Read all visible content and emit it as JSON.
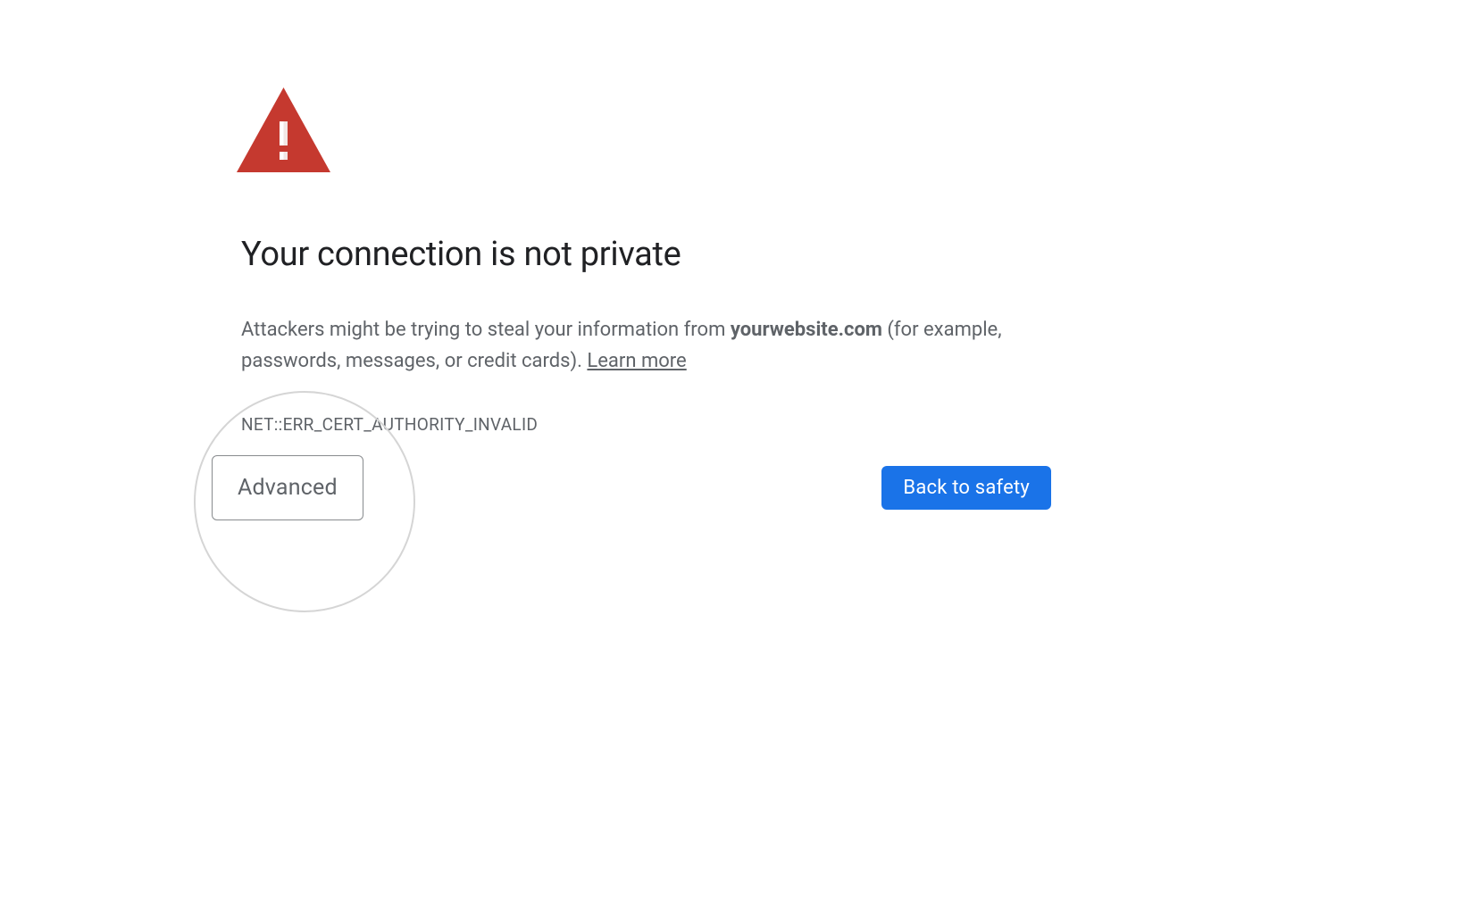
{
  "warning": {
    "icon_color": "#c5392f",
    "heading": "Your connection is not private",
    "description_prefix": "Attackers might be trying to steal your information from ",
    "description_host": "yourwebsite.com",
    "description_suffix": " (for example, passwords, messages, or credit cards). ",
    "learn_more_label": "Learn more",
    "error_code": "NET::ERR_CERT_AUTHORITY_INVALID"
  },
  "buttons": {
    "advanced_label": "Advanced",
    "back_to_safety_label": "Back to safety"
  }
}
